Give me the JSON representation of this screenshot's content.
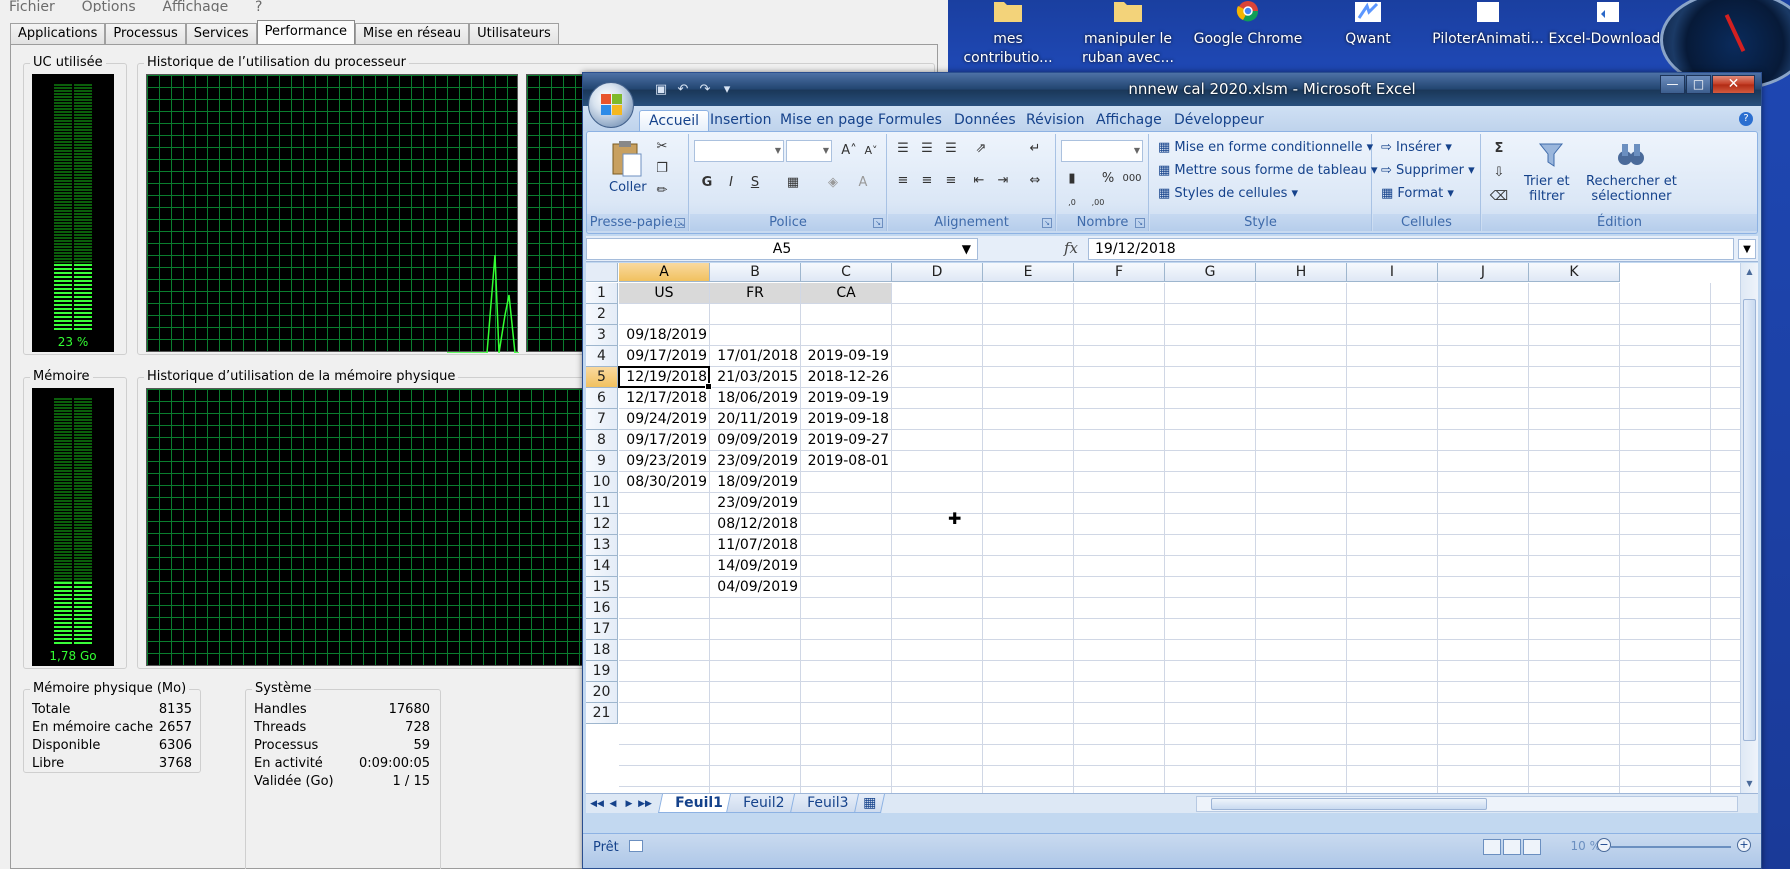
{
  "taskmgr": {
    "menu": [
      "Fichier",
      "Options",
      "Affichage",
      "?"
    ],
    "tabs": [
      "Applications",
      "Processus",
      "Services",
      "Performance",
      "Mise en réseau",
      "Utilisateurs"
    ],
    "active_tab": "Performance",
    "cpu_usage_title": "UC utilisée",
    "cpu_usage_value": "23 %",
    "cpu_history_title": "Historique de l’utilisation du processeur",
    "mem_title": "Mémoire",
    "mem_value": "1,78 Go",
    "mem_history_title": "Historique d’utilisation de la mémoire physique",
    "physmem": {
      "title": "Mémoire physique (Mo)",
      "rows": [
        {
          "k": "Totale",
          "v": "8135"
        },
        {
          "k": "En mémoire cache",
          "v": "2657"
        },
        {
          "k": "Disponible",
          "v": "6306"
        },
        {
          "k": "Libre",
          "v": "3768"
        }
      ]
    },
    "system": {
      "title": "Système",
      "rows": [
        {
          "k": "Handles",
          "v": "17680"
        },
        {
          "k": "Threads",
          "v": "728"
        },
        {
          "k": "Processus",
          "v": "59"
        },
        {
          "k": "En activité",
          "v": "0:09:00:05"
        },
        {
          "k": "Validée (Go)",
          "v": "1 / 15"
        }
      ]
    }
  },
  "desktop": {
    "icons": [
      {
        "label1": "mes",
        "label2": "contributio..."
      },
      {
        "label1": "manipuler le",
        "label2": "ruban avec..."
      },
      {
        "label1": "Google Chrome",
        "label2": ""
      },
      {
        "label1": "Qwant",
        "label2": ""
      },
      {
        "label1": "PiloterAnimati...",
        "label2": ""
      },
      {
        "label1": "Excel-Downloads",
        "label2": ""
      }
    ]
  },
  "excel": {
    "title": "nnnew cal 2020.xlsm - Microsoft Excel",
    "ribbon_tabs": [
      "Accueil",
      "Insertion",
      "Mise en page",
      "Formules",
      "Données",
      "Révision",
      "Affichage",
      "Développeur"
    ],
    "active_ribbon_tab": "Accueil",
    "groups": {
      "clipboard": {
        "label": "Presse-papie...",
        "paste": "Coller"
      },
      "font": {
        "label": "Police",
        "bold": "G",
        "italic": "I",
        "underline": "S"
      },
      "alignment": {
        "label": "Alignement"
      },
      "number": {
        "label": "Nombre",
        "percent": "%",
        "thousands": "000",
        "inc_dec": ",0 ,00",
        "dec_dec": ",00 ,0"
      },
      "style": {
        "label": "Style",
        "cond_format": "Mise en forme conditionnelle",
        "format_table": "Mettre sous forme de tableau",
        "cell_styles": "Styles de cellules"
      },
      "cells": {
        "label": "Cellules",
        "insert": "Insérer",
        "delete": "Supprimer",
        "format": "Format"
      },
      "editing": {
        "label": "Édition",
        "sort_line1": "Trier et",
        "sort_line2": "filtrer",
        "find_line1": "Rechercher et",
        "find_line2": "sélectionner",
        "sigma": "Σ"
      }
    },
    "name_box": "A5",
    "formula": "19/12/2018",
    "columns": [
      "A",
      "B",
      "C",
      "D",
      "E",
      "F",
      "G",
      "H",
      "I",
      "J",
      "K"
    ],
    "selected_column": "A",
    "rows": [
      "1",
      "2",
      "3",
      "4",
      "5",
      "6",
      "7",
      "8",
      "9",
      "10",
      "11",
      "12",
      "13",
      "14",
      "15",
      "16",
      "17",
      "18",
      "19",
      "20",
      "21"
    ],
    "selected_row": "5",
    "headers": {
      "A": "US",
      "B": "FR",
      "C": "CA"
    },
    "col_A": [
      "",
      "",
      "09/18/2019",
      "09/17/2019",
      "12/19/2018",
      "12/17/2018",
      "09/24/2019",
      "09/17/2019",
      "09/23/2019",
      "08/30/2019",
      "",
      "",
      "",
      "",
      ""
    ],
    "col_B": [
      "",
      "",
      "",
      "17/01/2018",
      "21/03/2015",
      "18/06/2019",
      "20/11/2019",
      "09/09/2019",
      "23/09/2019",
      "18/09/2019",
      "23/09/2019",
      "08/12/2018",
      "11/07/2018",
      "14/09/2019",
      "04/09/2019"
    ],
    "col_C": [
      "",
      "",
      "",
      "2019-09-19",
      "2018-12-26",
      "2019-09-19",
      "2019-09-18",
      "2019-09-27",
      "2019-08-01",
      "",
      "",
      "",
      "",
      "",
      ""
    ],
    "sheet_tabs": [
      "Feuil1",
      "Feuil2",
      "Feuil3"
    ],
    "active_sheet": "Feuil1",
    "status": "Prêt",
    "zoom": "10 %"
  }
}
